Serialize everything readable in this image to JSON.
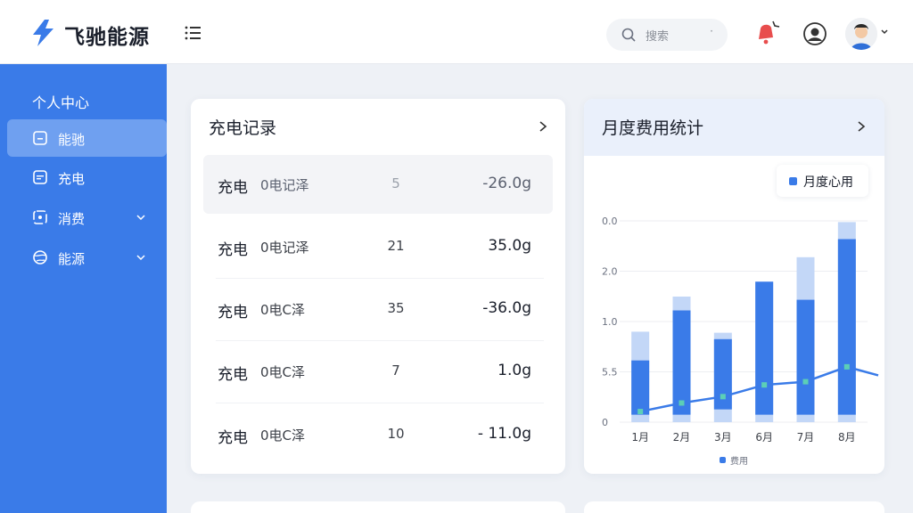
{
  "app": {
    "brand": "飞驰能源",
    "brand_color": "#3a7be8"
  },
  "header": {
    "search_placeholder": "搜索",
    "search_caret": "·",
    "icons": [
      "menu-icon",
      "search-icon",
      "notification-bell-icon",
      "support-icon",
      "user-avatar"
    ]
  },
  "sidebar": {
    "title": "个人中心",
    "items": [
      {
        "label": "能驰",
        "icon": "wallet-icon",
        "active": true,
        "has_caret": false
      },
      {
        "label": "充电",
        "icon": "document-icon",
        "active": false,
        "has_caret": false
      },
      {
        "label": "消费",
        "icon": "receipt-icon",
        "active": false,
        "has_caret": true
      },
      {
        "label": "能源",
        "icon": "globe-icon",
        "active": false,
        "has_caret": true
      }
    ]
  },
  "records_card": {
    "title": "充电记录",
    "rows": [
      {
        "type": "充电",
        "desc": "0电记泽",
        "num": "5",
        "amount": "-26.0g"
      },
      {
        "type": "充电",
        "desc": "0电记泽",
        "num": "21",
        "amount": "35.0g"
      },
      {
        "type": "充电",
        "desc": "0电C泽",
        "num": "35",
        "amount": "-36.0g"
      },
      {
        "type": "充电",
        "desc": "0电C泽",
        "num": "7",
        "amount": "1.0g"
      },
      {
        "type": "充电",
        "desc": "0电C泽",
        "num": "10",
        "amount": "- 11.0g"
      }
    ]
  },
  "chart_card": {
    "title": "月度费用统计",
    "legend": "月度心用",
    "footer_legend": "费用"
  },
  "chart_data": {
    "type": "bar",
    "categories": [
      "1月",
      "2月",
      "3月",
      "6月",
      "7月",
      "8月"
    ],
    "y_tick_labels": [
      "0",
      "5.5",
      "1.0",
      "2.0",
      "0.0"
    ],
    "series": [
      {
        "name": "月度心用",
        "values": [
          0.58,
          1.05,
          0.78,
          1.32,
          1.15,
          1.72
        ],
        "color": "#3a7be8"
      },
      {
        "values": [
          0.85,
          1.18,
          0.84,
          1.32,
          1.55,
          1.88
        ],
        "color": "#c3d7f7"
      },
      {
        "name": "费用",
        "type": "line",
        "values": [
          0.1,
          0.18,
          0.24,
          0.35,
          0.38,
          0.52
        ],
        "color": "#3a7be8"
      }
    ],
    "ylim": [
      0,
      1.95
    ],
    "grid": true,
    "legend_position": "top-right"
  }
}
